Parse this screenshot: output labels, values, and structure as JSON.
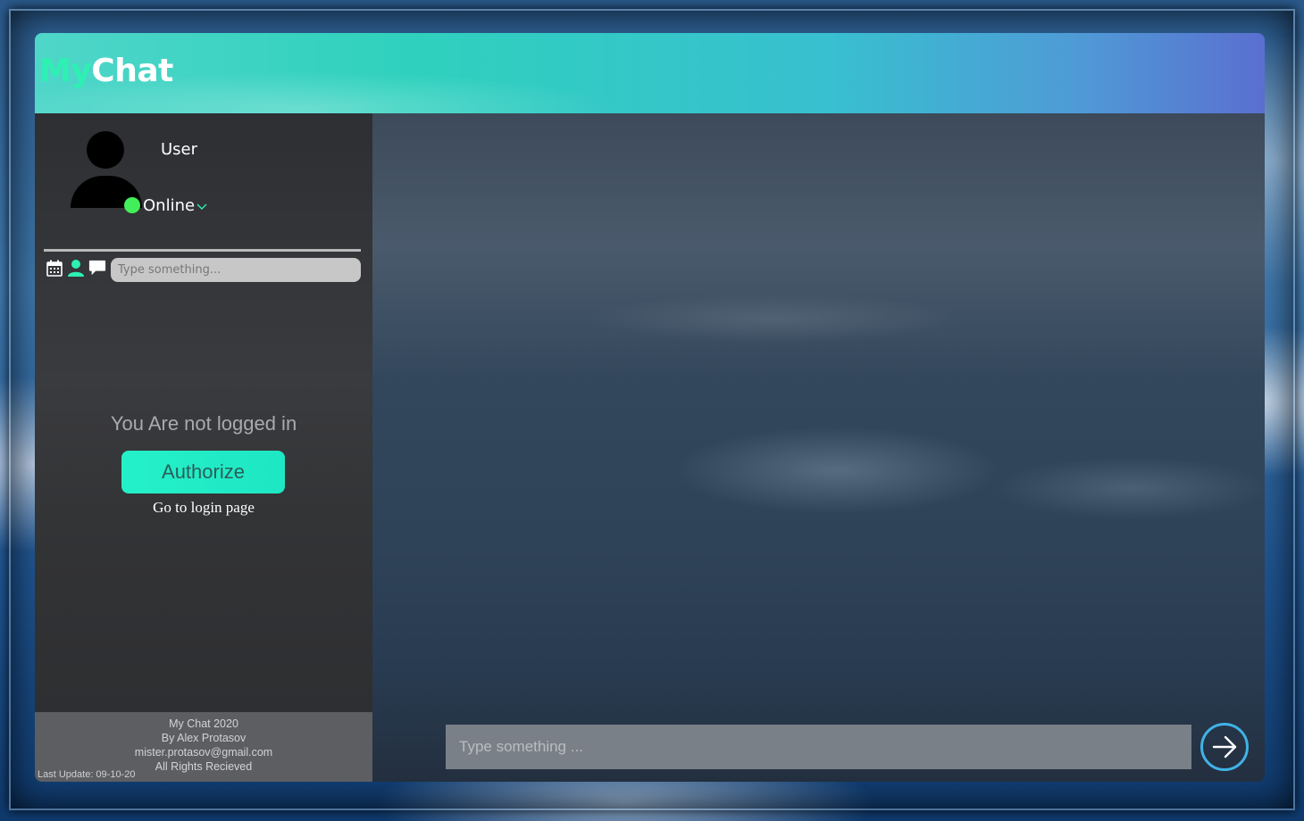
{
  "app": {
    "logo_my": "My",
    "logo_chat": "Chat"
  },
  "profile": {
    "name": "User",
    "status": "Online"
  },
  "toolbar": {
    "icons": [
      "calendar-icon",
      "contacts-icon",
      "chat-bubble-icon"
    ],
    "search_placeholder": "Type something..."
  },
  "auth": {
    "message": "You Are not logged in",
    "button_label": "Authorize",
    "login_link": "Go to login page"
  },
  "footer": {
    "line1": "My Chat 2020",
    "line2": "By Alex Protasov",
    "line3": "mister.protasov@gmail.com",
    "line4": "All Rights Recieved",
    "last_update": "Last Update: 09-10-20"
  },
  "composer": {
    "placeholder": "Type something ..."
  },
  "colors": {
    "accent": "#2ef0b2",
    "button": "#24f0c8",
    "online": "#42ef5a",
    "send_ring": "#3fb3e6"
  }
}
